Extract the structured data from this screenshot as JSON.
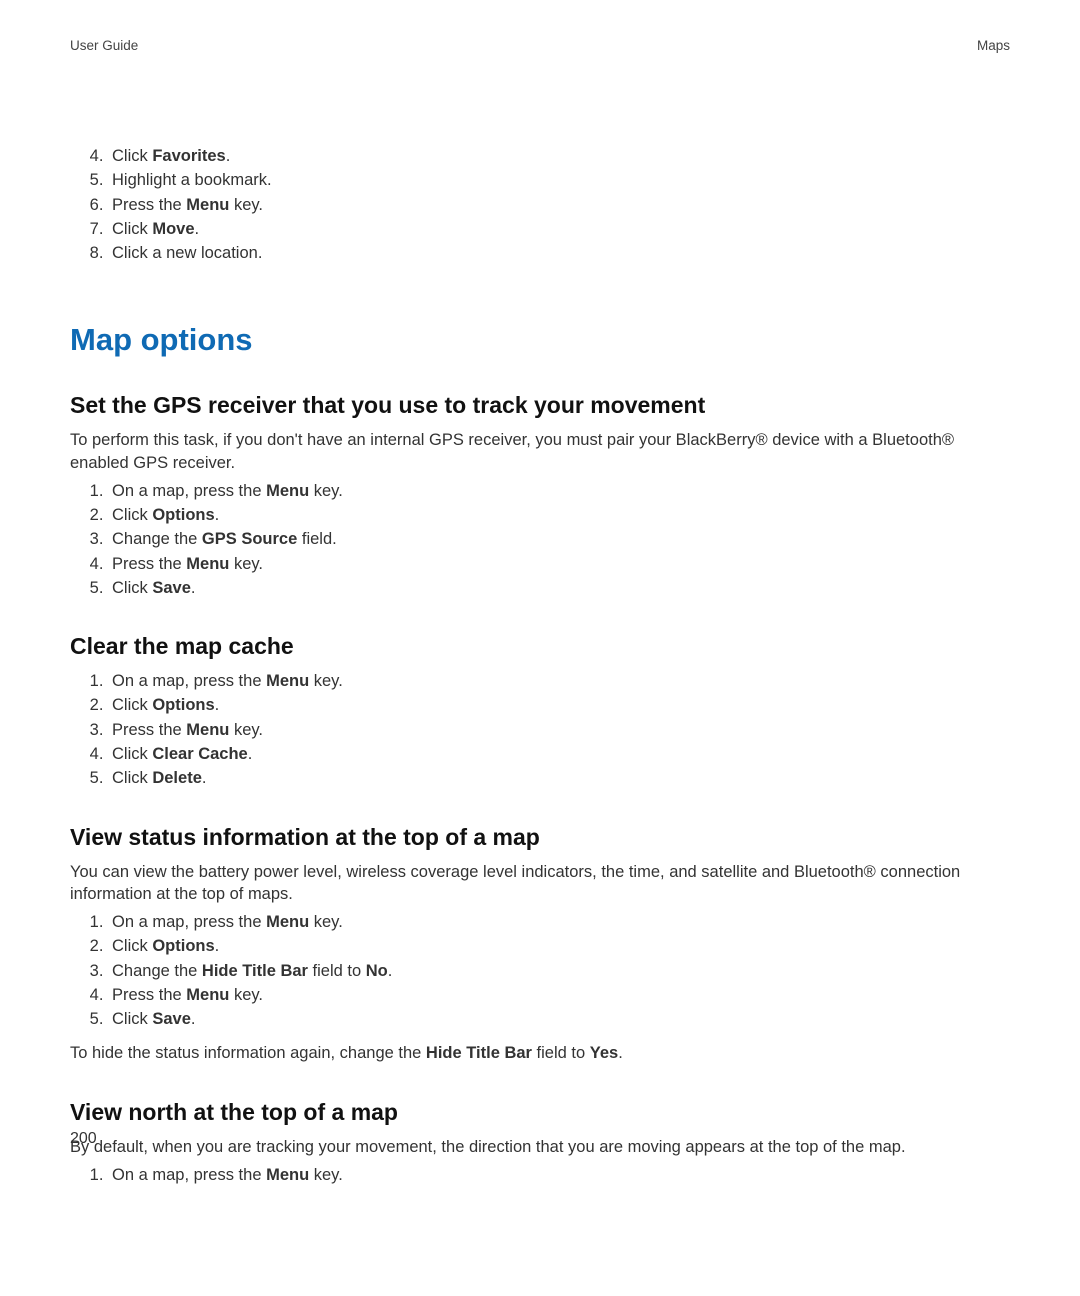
{
  "header": {
    "left": "User Guide",
    "right": "Maps"
  },
  "top_list_start": 4,
  "top_list": [
    {
      "pre": "Click ",
      "bold": "Favorites",
      "post": "."
    },
    {
      "pre": "Highlight a bookmark.",
      "bold": "",
      "post": ""
    },
    {
      "pre": "Press the ",
      "bold": "Menu",
      "post": " key."
    },
    {
      "pre": "Click ",
      "bold": "Move",
      "post": "."
    },
    {
      "pre": "Click a new location.",
      "bold": "",
      "post": ""
    }
  ],
  "section_title": "Map options",
  "subsections": [
    {
      "title": "Set the GPS receiver that you use to track your movement",
      "intro_segments": [
        {
          "t": "To perform this task, if you don't have an internal GPS receiver, you must pair your BlackBerry® device with a Bluetooth® enabled GPS receiver."
        }
      ],
      "steps": [
        {
          "pre": "On a map, press the ",
          "bold": "Menu",
          "post": " key."
        },
        {
          "pre": "Click ",
          "bold": "Options",
          "post": "."
        },
        {
          "pre": "Change the ",
          "bold": "GPS Source",
          "post": " field."
        },
        {
          "pre": "Press the ",
          "bold": "Menu",
          "post": " key."
        },
        {
          "pre": "Click ",
          "bold": "Save",
          "post": "."
        }
      ]
    },
    {
      "title": "Clear the map cache",
      "intro_segments": [],
      "steps": [
        {
          "pre": "On a map, press the ",
          "bold": "Menu",
          "post": " key."
        },
        {
          "pre": "Click ",
          "bold": "Options",
          "post": "."
        },
        {
          "pre": "Press the ",
          "bold": "Menu",
          "post": " key."
        },
        {
          "pre": "Click ",
          "bold": "Clear Cache",
          "post": "."
        },
        {
          "pre": "Click ",
          "bold": "Delete",
          "post": "."
        }
      ]
    },
    {
      "title": "View status information at the top of a map",
      "intro_segments": [
        {
          "t": "You can view the battery power level, wireless coverage level indicators, the time, and satellite and Bluetooth® connection information at the top of maps."
        }
      ],
      "steps": [
        {
          "pre": "On a map, press the ",
          "bold": "Menu",
          "post": " key."
        },
        {
          "pre": "Click ",
          "bold": "Options",
          "post": "."
        },
        {
          "pre": "Change the ",
          "bold": "Hide Title Bar",
          "post": " field to ",
          "bold2": "No",
          "post2": "."
        },
        {
          "pre": "Press the ",
          "bold": "Menu",
          "post": " key."
        },
        {
          "pre": "Click ",
          "bold": "Save",
          "post": "."
        }
      ],
      "outro_segments": [
        {
          "t": "To hide the status information again, change the "
        },
        {
          "b": "Hide Title Bar"
        },
        {
          "t": " field to "
        },
        {
          "b": "Yes"
        },
        {
          "t": "."
        }
      ]
    },
    {
      "title": "View north at the top of a map",
      "intro_segments": [
        {
          "t": "By default, when you are tracking your movement, the direction that you are moving appears at the top of the map."
        }
      ],
      "steps": [
        {
          "pre": "On a map, press the ",
          "bold": "Menu",
          "post": " key."
        }
      ]
    }
  ],
  "page_number": "200"
}
